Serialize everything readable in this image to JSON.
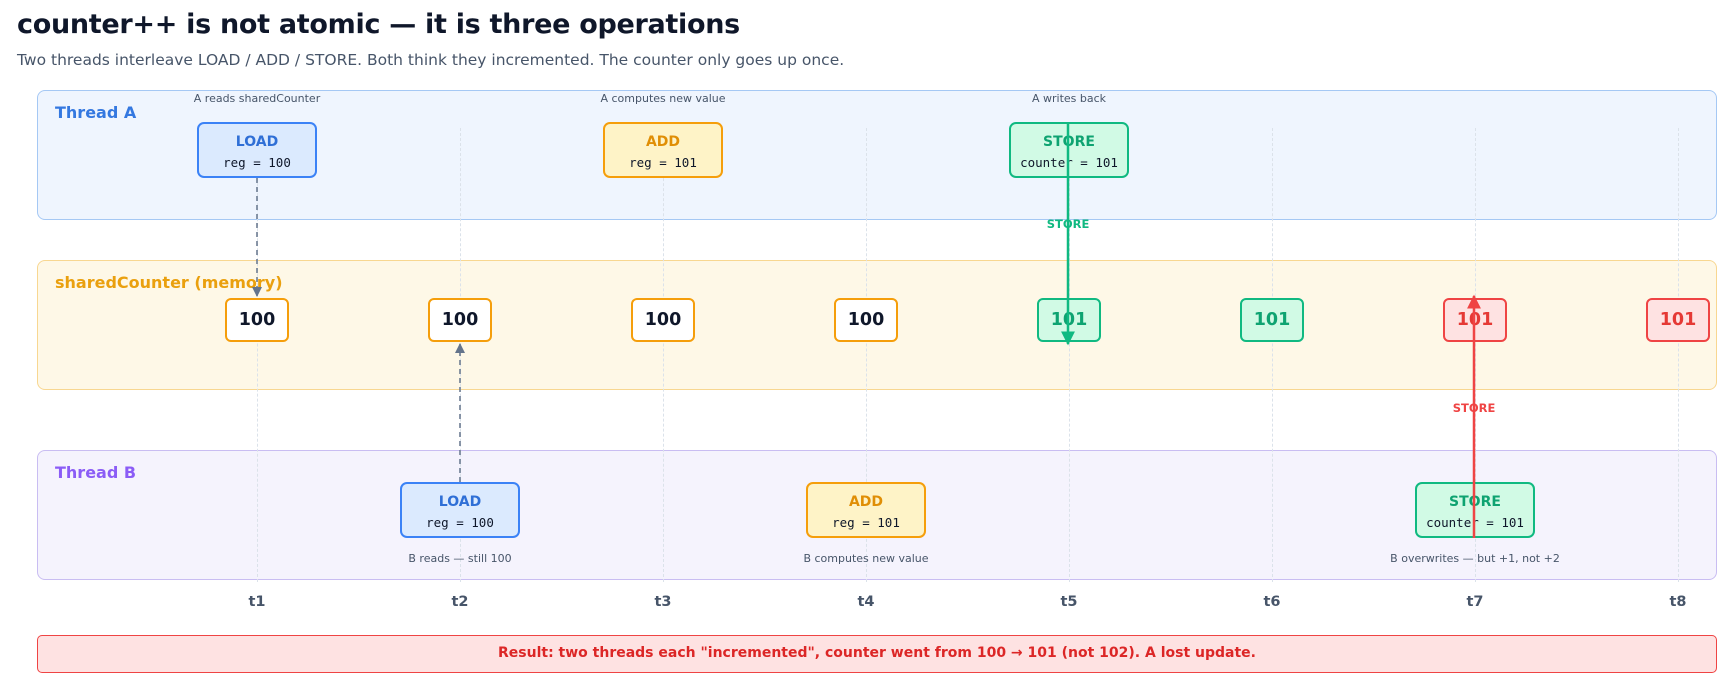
{
  "title": "counter++ is not atomic — it is three operations",
  "subtitle": "Two threads interleave LOAD / ADD / STORE. Both think they incremented. The counter only goes up once.",
  "lanes": {
    "thread_a": "Thread A",
    "memory": "sharedCounter (memory)",
    "thread_b": "Thread B"
  },
  "ticks": [
    "t1",
    "t2",
    "t3",
    "t4",
    "t5",
    "t6",
    "t7",
    "t8"
  ],
  "thread_a_ops": [
    {
      "tick": 0,
      "op": "LOAD",
      "detail": "reg = 100",
      "caption": "A reads sharedCounter"
    },
    {
      "tick": 2,
      "op": "ADD",
      "detail": "reg = 101",
      "caption": "A computes new value"
    },
    {
      "tick": 4,
      "op": "STORE",
      "detail": "counter = 101",
      "caption": "A writes back"
    }
  ],
  "thread_b_ops": [
    {
      "tick": 1,
      "op": "LOAD",
      "detail": "reg = 100",
      "caption": "B reads — still 100"
    },
    {
      "tick": 3,
      "op": "ADD",
      "detail": "reg = 101",
      "caption": "B computes new value"
    },
    {
      "tick": 6,
      "op": "STORE",
      "detail": "counter = 101",
      "caption": "B overwrites — but +1, not +2"
    }
  ],
  "memory_values": [
    {
      "value": "100",
      "state": "original"
    },
    {
      "value": "100",
      "state": "original"
    },
    {
      "value": "100",
      "state": "original"
    },
    {
      "value": "100",
      "state": "original"
    },
    {
      "value": "101",
      "state": "written"
    },
    {
      "value": "101",
      "state": "written"
    },
    {
      "value": "101",
      "state": "overwritten"
    },
    {
      "value": "101",
      "state": "overwritten"
    }
  ],
  "store_labels": {
    "a": "STORE",
    "b": "STORE"
  },
  "result": "Result: two threads each \"incremented\", counter went from 100 → 101 (not 102). A lost update.",
  "colors": {
    "load": "#3b82f6",
    "add": "#f59e0b",
    "store": "#10b981",
    "lost_update": "#ef4444",
    "read_arrow": "#64748b",
    "thread_a": "#3478e0",
    "memory": "#eaa00e",
    "thread_b": "#8b5cf6"
  }
}
